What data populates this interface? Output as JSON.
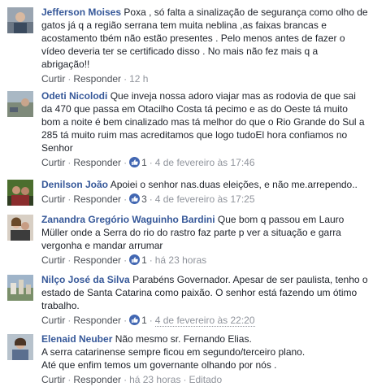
{
  "ui": {
    "reply_label": "Curtir",
    "respond_label": "Responder",
    "edited_label": "Editado",
    "separator": "·"
  },
  "comments": [
    {
      "author": "Jefferson Moises",
      "text": "Poxa , só falta a sinalização de segurança como olho de gatos já q a região serrana tem muita neblina ,as faixas brancas e acostamento tbém não estão presentes . Pelo menos antes de fazer o vídeo deveria ter se certificado disso . No mais não fez mais q a abrigação!!",
      "time": "12 h",
      "likes": null
    },
    {
      "author": "Odeti Nicolodi",
      "text": "Que inveja nossa adoro viajar mas as rodovia de que sai da 470 que passa em Otacilho Costa tá pecimo e as do Oeste tá muito bom a noite é bem cinalizado mas tá melhor do que o Rio Grande do Sul a 285 tá muito ruim mas acreditamos que logo tudoEl hora confiamos no Senhor",
      "time": "4 de fevereiro às 17:46",
      "likes": "1"
    },
    {
      "author": "Denilson João",
      "text": "Apoiei o senhor nas.duas eleições, e não me.arrependo..",
      "time": "4 de fevereiro às 17:25",
      "likes": "3"
    },
    {
      "author": "Zanandra Gregório Waguinho Bardini",
      "text": "Que bom q passou em Lauro Müller onde a Serra do rio do rastro faz parte p ver a situação e garra vergonha e mandar arrumar",
      "time": "há 23 horas",
      "likes": "1"
    },
    {
      "author": "Nilço José da Silva",
      "text": "Parabéns Governador. Apesar de ser paulista, tenho o estado de Santa Catarina como paixão. O senhor está fazendo um ótimo trabalho.",
      "time": "4 de fevereiro às 22:20",
      "likes": "1"
    },
    {
      "author": "Elenaid Neuber",
      "text_lines": [
        "Não mesmo sr. Fernando Elias.",
        "A serra catarinense sempre ficou em segundo/terceiro plano.",
        "Até que enfim temos um governante olhando por nós ."
      ],
      "time": "há 23 horas",
      "likes": null,
      "edited": true
    }
  ],
  "colors": {
    "author": "#365899",
    "text": "#1d2129",
    "meta": "#90949c",
    "action": "#4b4f56",
    "like_badge": "#4267b2"
  },
  "icons": [
    "avatar",
    "thumbs-up-icon"
  ]
}
